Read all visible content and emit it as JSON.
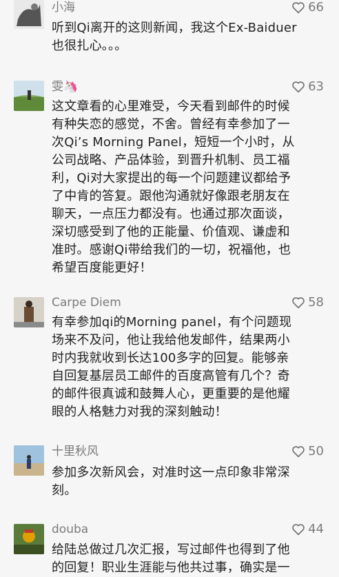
{
  "comments": [
    {
      "name": "小海",
      "likes": "66",
      "lines": [
        "听到Qi离开的这则新闻，我这个Ex-Baiduer",
        "也很扎心。。。"
      ]
    },
    {
      "name": "雯🦄",
      "likes": "63",
      "lines": [
        "这文章看的心里难受，今天看到邮件的时候",
        "有种失恋的感觉，不舍。曾经有幸参加了一",
        "次Qi’s Morning Panel，短短一个小时，从",
        "公司战略、产品体验，到晋升机制、员工福",
        "利，Qi对大家提出的每一个问题建议都给予",
        "了中肯的答复。跟他沟通就好像跟老朋友在",
        "聊天，一点压力都没有。也通过那次面谈，",
        "深切感受到了他的正能量、价值观、谦虚和",
        "准时。感谢Qi带给我们的一切，祝福他，也",
        "希望百度能更好！"
      ]
    },
    {
      "name": "Carpe Diem",
      "likes": "58",
      "lines": [
        "有幸参加qi的Morning panel，有个问题现",
        "场来不及问，他让我给他发邮件，结果两小",
        "时内我就收到长达100多字的回复。能够亲",
        "自回复基层员工邮件的百度高管有几个？奇",
        "的邮件很真诚和鼓舞人心，更重要的是他耀",
        "眼的人格魅力对我的深刻触动！"
      ]
    },
    {
      "name": "十里秋风",
      "likes": "50",
      "lines": [
        "参加多次新风会，对准时这一点印象非常深",
        "刻。"
      ]
    },
    {
      "name": "douba",
      "likes": "44",
      "lines": [
        "给陆总做过几次汇报，写过邮件也得到了他",
        "的回复！职业生涯能与他共过事，确实是一"
      ]
    }
  ]
}
